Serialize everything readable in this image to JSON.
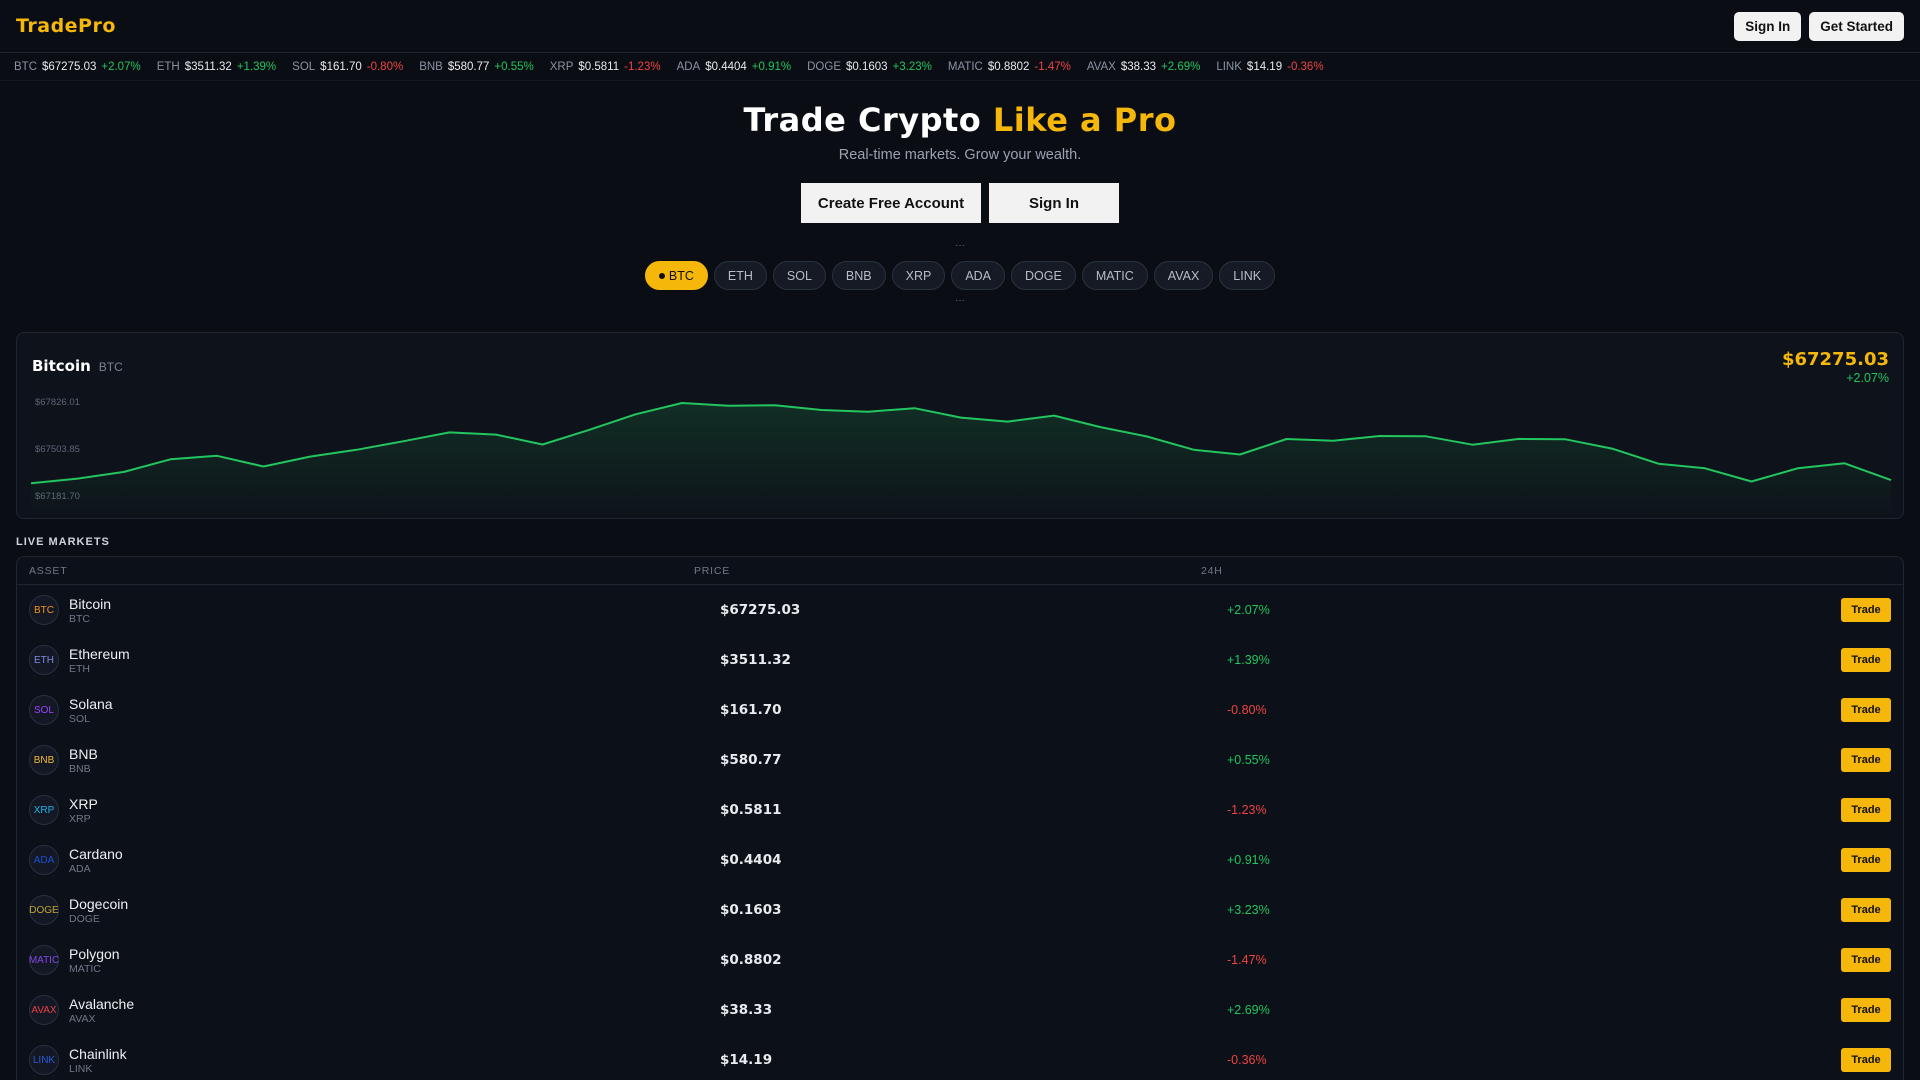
{
  "header": {
    "logo": "TradePro",
    "signin": "Sign In",
    "get_started": "Get Started"
  },
  "ticker": [
    {
      "sym": "BTC",
      "price": "$67275.03",
      "change": "+2.07%",
      "dir": "up"
    },
    {
      "sym": "ETH",
      "price": "$3511.32",
      "change": "+1.39%",
      "dir": "up"
    },
    {
      "sym": "SOL",
      "price": "$161.70",
      "change": "-0.80%",
      "dir": "down"
    },
    {
      "sym": "BNB",
      "price": "$580.77",
      "change": "+0.55%",
      "dir": "up"
    },
    {
      "sym": "XRP",
      "price": "$0.5811",
      "change": "-1.23%",
      "dir": "down"
    },
    {
      "sym": "ADA",
      "price": "$0.4404",
      "change": "+0.91%",
      "dir": "up"
    },
    {
      "sym": "DOGE",
      "price": "$0.1603",
      "change": "+3.23%",
      "dir": "up"
    },
    {
      "sym": "MATIC",
      "price": "$0.8802",
      "change": "-1.47%",
      "dir": "down"
    },
    {
      "sym": "AVAX",
      "price": "$38.33",
      "change": "+2.69%",
      "dir": "up"
    },
    {
      "sym": "LINK",
      "price": "$14.19",
      "change": "-0.36%",
      "dir": "down"
    }
  ],
  "hero": {
    "title_main": "Trade Crypto",
    "title_accent": "Like a Pro",
    "subtitle": "Real-time markets. Grow your wealth.",
    "cta_primary": "Create Free Account",
    "cta_secondary": "Sign In",
    "dots": "···"
  },
  "pills": [
    "BTC",
    "ETH",
    "SOL",
    "BNB",
    "XRP",
    "ADA",
    "DOGE",
    "MATIC",
    "AVAX",
    "LINK"
  ],
  "active_pill": "BTC",
  "chart_card": {
    "name": "Bitcoin",
    "sym": "BTC",
    "price": "$67275.03",
    "change": "+2.07%"
  },
  "chart_data": {
    "type": "area",
    "y_ticks": [
      "$67826.01",
      "$67503.85",
      "$67181.70"
    ],
    "ylim": [
      67181.7,
      67826.01
    ],
    "values": [
      67196,
      67232,
      67285,
      67384,
      67411,
      67327,
      67405,
      67458,
      67525,
      67595,
      67578,
      67500,
      67615,
      67737,
      67826,
      67805,
      67808,
      67771,
      67758,
      67785,
      67711,
      67680,
      67727,
      67637,
      67563,
      67459,
      67421,
      67543,
      67529,
      67567,
      67564,
      67498,
      67544,
      67541,
      67468,
      67349,
      67313,
      67209,
      67314,
      67352,
      67220
    ],
    "color": "#22c55e"
  },
  "markets": {
    "label": "LIVE MARKETS",
    "columns": [
      "ASSET",
      "PRICE",
      "24H"
    ],
    "trade_label": "Trade",
    "rows": [
      {
        "name": "Bitcoin",
        "sym": "BTC",
        "price": "$67275.03",
        "change": "+2.07%",
        "dir": "up",
        "color": "#f7931a"
      },
      {
        "name": "Ethereum",
        "sym": "ETH",
        "price": "$3511.32",
        "change": "+1.39%",
        "dir": "up",
        "color": "#7b8cde"
      },
      {
        "name": "Solana",
        "sym": "SOL",
        "price": "$161.70",
        "change": "-0.80%",
        "dir": "down",
        "color": "#9945ff"
      },
      {
        "name": "BNB",
        "sym": "BNB",
        "price": "$580.77",
        "change": "+0.55%",
        "dir": "up",
        "color": "#f3ba2f"
      },
      {
        "name": "XRP",
        "sym": "XRP",
        "price": "$0.5811",
        "change": "-1.23%",
        "dir": "down",
        "color": "#23b5e8"
      },
      {
        "name": "Cardano",
        "sym": "ADA",
        "price": "$0.4404",
        "change": "+0.91%",
        "dir": "up",
        "color": "#1a4fd0"
      },
      {
        "name": "Dogecoin",
        "sym": "DOGE",
        "price": "$0.1603",
        "change": "+3.23%",
        "dir": "up",
        "color": "#c2a633"
      },
      {
        "name": "Polygon",
        "sym": "MATIC",
        "price": "$0.8802",
        "change": "-1.47%",
        "dir": "down",
        "color": "#8247e5"
      },
      {
        "name": "Avalanche",
        "sym": "AVAX",
        "price": "$38.33",
        "change": "+2.69%",
        "dir": "up",
        "color": "#e84142"
      },
      {
        "name": "Chainlink",
        "sym": "LINK",
        "price": "$14.19",
        "change": "-0.36%",
        "dir": "down",
        "color": "#2a5ada"
      }
    ]
  }
}
